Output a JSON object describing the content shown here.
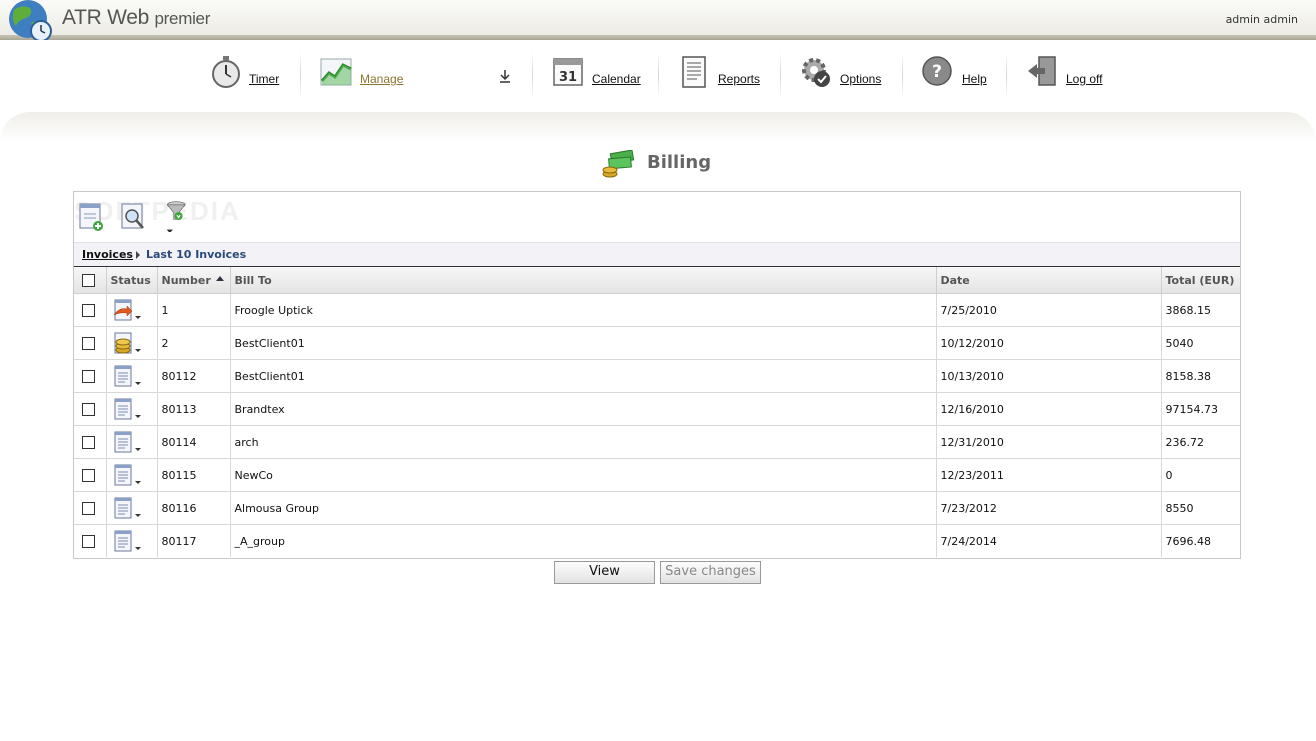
{
  "app": {
    "title_main": "ATR Web",
    "title_sub": "premier",
    "user": "admin admin"
  },
  "nav": {
    "items": [
      {
        "label": "Timer",
        "icon": "stopwatch-icon"
      },
      {
        "label": "Manage",
        "icon": "chart-icon",
        "active": true
      },
      {
        "label": "Calendar",
        "icon": "calendar-icon",
        "day": "31"
      },
      {
        "label": "Reports",
        "icon": "report-icon"
      },
      {
        "label": "Options",
        "icon": "gear-icon"
      },
      {
        "label": "Help",
        "icon": "help-icon"
      },
      {
        "label": "Log off",
        "icon": "logoff-icon"
      }
    ]
  },
  "page": {
    "title": "Billing"
  },
  "toolbar": {
    "watermark": "SOFTPEDIA"
  },
  "breadcrumb": {
    "root": "Invoices",
    "current": "Last 10 Invoices"
  },
  "table": {
    "columns": [
      "Status",
      "Number",
      "Bill To",
      "Date",
      "Total (EUR)"
    ],
    "rows": [
      {
        "status": "sent",
        "number": "1",
        "bill_to": "Froogle Uptick",
        "date": "7/25/2010",
        "total": "3868.15"
      },
      {
        "status": "paid",
        "number": "2",
        "bill_to": "BestClient01",
        "date": "10/12/2010",
        "total": "5040"
      },
      {
        "status": "draft",
        "number": "80112",
        "bill_to": "BestClient01",
        "date": "10/13/2010",
        "total": "8158.38"
      },
      {
        "status": "draft",
        "number": "80113",
        "bill_to": "Brandtex",
        "date": "12/16/2010",
        "total": "97154.73"
      },
      {
        "status": "draft",
        "number": "80114",
        "bill_to": "arch",
        "date": "12/31/2010",
        "total": "236.72"
      },
      {
        "status": "draft",
        "number": "80115",
        "bill_to": "NewCo",
        "date": "12/23/2011",
        "total": "0"
      },
      {
        "status": "draft",
        "number": "80116",
        "bill_to": "Almousa Group",
        "date": "7/23/2012",
        "total": "8550"
      },
      {
        "status": "draft",
        "number": "80117",
        "bill_to": "_A_group",
        "date": "7/24/2014",
        "total": "7696.48"
      }
    ]
  },
  "buttons": {
    "view": "View",
    "save": "Save changes"
  },
  "colors": {
    "active_nav": "#8a7530",
    "breadcrumb_current": "#2a4a7a"
  }
}
